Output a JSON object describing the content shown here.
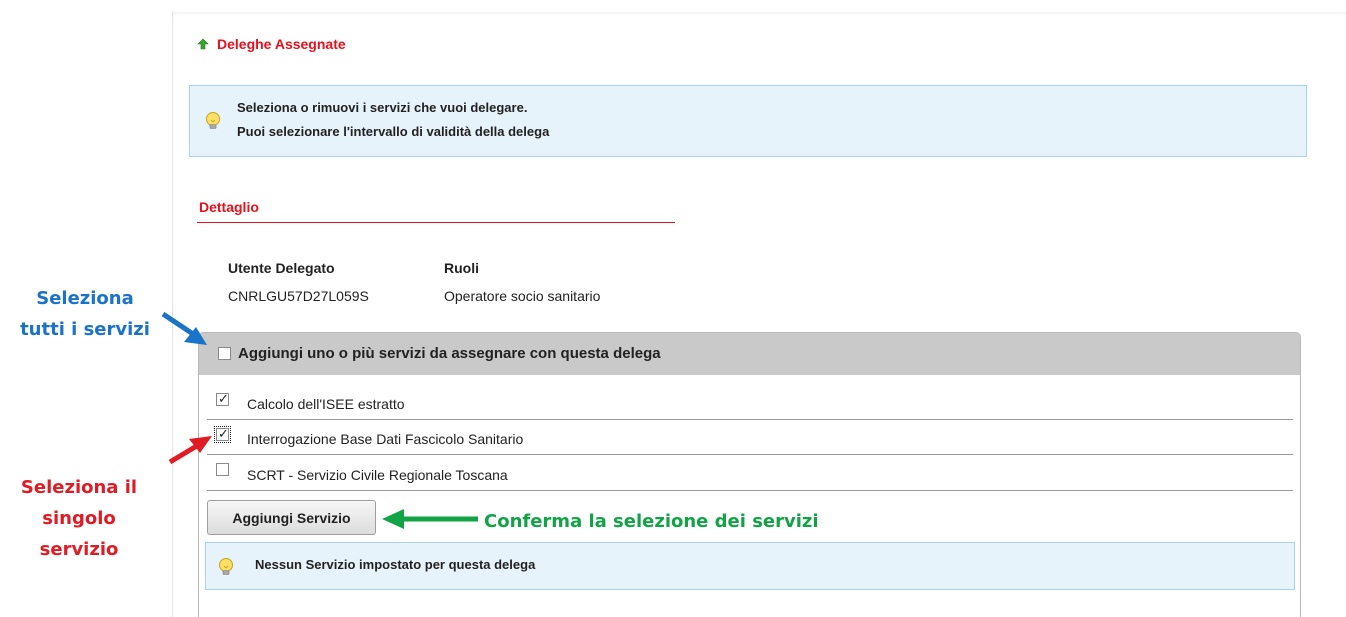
{
  "section": {
    "title": "Deleghe Assegnate"
  },
  "info": {
    "line1": "Seleziona o rimuovi i servizi che vuoi delegare.",
    "line2": "Puoi selezionare l'intervallo di validità della delega"
  },
  "detail": {
    "title": "Dettaglio",
    "user_header": "Utente Delegato",
    "roles_header": "Ruoli",
    "user_value": "CNRLGU57D27L059S",
    "roles_value": "Operatore socio sanitario"
  },
  "services": {
    "header_label": "Aggiungi uno o più servizi da assegnare con questa delega",
    "select_all_checked": false,
    "items": [
      {
        "label": "Calcolo dell'ISEE estratto",
        "checked": true
      },
      {
        "label": "Interrogazione Base Dati Fascicolo Sanitario",
        "checked": true
      },
      {
        "label": "SCRT - Servizio Civile Regionale Toscana",
        "checked": false
      }
    ],
    "add_button_label": "Aggiungi Servizio",
    "empty_message": "Nessun Servizio impostato per questa delega"
  },
  "annotations": {
    "select_all": [
      "Seleziona",
      "tutti i servizi"
    ],
    "select_single": [
      "Seleziona il",
      "singolo",
      "servizio"
    ],
    "confirm": "Conferma la selezione dei servizi"
  },
  "colors": {
    "title_red": "#e8101c",
    "info_bg": "#e7f3fb",
    "header_gray": "#c9c9c9",
    "annot_blue": "#1a73c7",
    "annot_red": "#e01b24",
    "annot_green": "#13a347"
  },
  "icons": {
    "section": "up-arrow-icon",
    "info": "lightbulb-icon",
    "checkbox_tick": "check-icon"
  }
}
